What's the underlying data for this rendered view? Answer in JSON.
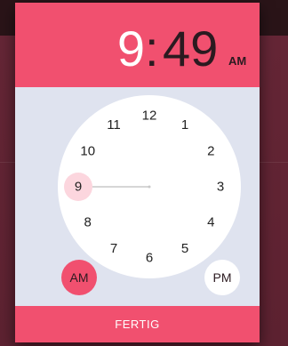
{
  "time_display": {
    "hour": "9",
    "colon": ":",
    "minute": "49",
    "period": "AM"
  },
  "clock": {
    "numbers": [
      "12",
      "1",
      "2",
      "3",
      "4",
      "5",
      "6",
      "7",
      "8",
      "9",
      "10",
      "11"
    ],
    "selected_hour": "9"
  },
  "period_buttons": {
    "am_label": "AM",
    "pm_label": "PM",
    "selected": "AM"
  },
  "footer": {
    "done_label": "FERTIG"
  },
  "colors": {
    "accent": "#f1506f",
    "dial": "#ffffff",
    "dialog_body": "#dfe3ef",
    "selected_hour_bg": "#fcd6de",
    "hand": "#c8c8c8"
  }
}
